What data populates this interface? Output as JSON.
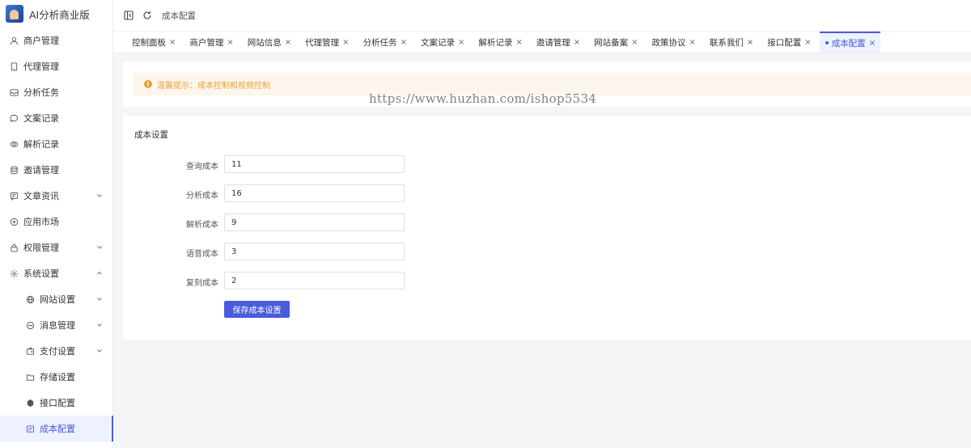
{
  "app": {
    "title": "AI分析商业版"
  },
  "topbar": {
    "breadcrumb": "成本配置"
  },
  "sidebar": {
    "items": [
      {
        "label": "商户管理",
        "icon": "user-icon",
        "expandable": false
      },
      {
        "label": "代理管理",
        "icon": "tablet-icon",
        "expandable": false
      },
      {
        "label": "分析任务",
        "icon": "inbox-icon",
        "expandable": false
      },
      {
        "label": "文案记录",
        "icon": "chat-icon",
        "expandable": false
      },
      {
        "label": "解析记录",
        "icon": "link-icon",
        "expandable": false
      },
      {
        "label": "邀请管理",
        "icon": "database-icon",
        "expandable": false
      },
      {
        "label": "文章资讯",
        "icon": "message-icon",
        "expandable": true
      },
      {
        "label": "应用市场",
        "icon": "apps-icon",
        "expandable": false
      },
      {
        "label": "权限管理",
        "icon": "lock-icon",
        "expandable": true
      },
      {
        "label": "系统设置",
        "icon": "gear-icon",
        "expandable": true
      }
    ],
    "sub_items": [
      {
        "label": "网站设置",
        "icon": "globe-icon",
        "expandable": true
      },
      {
        "label": "消息管理",
        "icon": "chat-bubble-icon",
        "expandable": true
      },
      {
        "label": "支付设置",
        "icon": "wallet-icon",
        "expandable": true
      },
      {
        "label": "存储设置",
        "icon": "folder-icon",
        "expandable": false
      },
      {
        "label": "接口配置",
        "icon": "plugin-icon",
        "expandable": false
      },
      {
        "label": "成本配置",
        "icon": "cost-icon",
        "expandable": false
      }
    ]
  },
  "tabs": [
    {
      "label": "控制面板"
    },
    {
      "label": "商户管理"
    },
    {
      "label": "网站信息"
    },
    {
      "label": "代理管理"
    },
    {
      "label": "分析任务"
    },
    {
      "label": "文案记录"
    },
    {
      "label": "解析记录"
    },
    {
      "label": "邀请管理"
    },
    {
      "label": "网站备案"
    },
    {
      "label": "政策协议"
    },
    {
      "label": "联系我们"
    },
    {
      "label": "接口配置"
    },
    {
      "label": "成本配置"
    }
  ],
  "tab_close": "×",
  "notice": {
    "icon": "!",
    "text": "温馨提示：成本控制和视频控制"
  },
  "watermark": "https://www.huzhan.com/ishop5534",
  "form": {
    "title": "成本设置",
    "fields": [
      {
        "label": "查询成本",
        "value": "11"
      },
      {
        "label": "分析成本",
        "value": "16"
      },
      {
        "label": "解析成本",
        "value": "9"
      },
      {
        "label": "语音成本",
        "value": "3"
      },
      {
        "label": "复刻成本",
        "value": "2"
      }
    ],
    "save_label": "保存成本设置"
  },
  "colors": {
    "accent": "#4a5bdc",
    "warning": "#e6a23c",
    "warning_bg": "#fdf6ec"
  }
}
